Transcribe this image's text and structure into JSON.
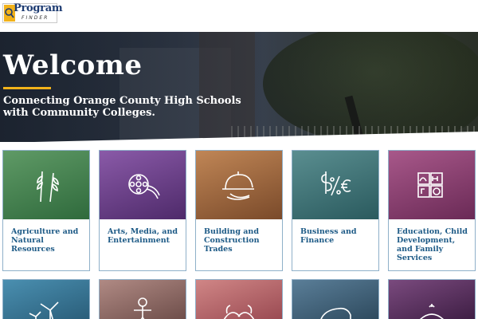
{
  "logo": {
    "word1": "Program",
    "word2": "FINDER"
  },
  "hero": {
    "title": "Welcome",
    "tagline": "Connecting Orange County High Schools with Community Colleges."
  },
  "cards": [
    {
      "label": "Agriculture and Natural Resources",
      "icon": "wheat-icon",
      "color": "#3f7a4a"
    },
    {
      "label": "Arts, Media, and Entertainment",
      "icon": "film-reel-icon",
      "color": "#6e3f8a"
    },
    {
      "label": "Building and Construction Trades",
      "icon": "hardhat-icon",
      "color": "#a0623c"
    },
    {
      "label": "Business and Finance",
      "icon": "currency-icon",
      "color": "#3c6e74"
    },
    {
      "label": "Education, Child Development, and Family Services",
      "icon": "blocks-icon",
      "color": "#8a3e6e"
    }
  ],
  "row2": [
    {
      "icon": "wind-turbine-icon",
      "color": "#2f6e8c"
    },
    {
      "icon": "stick-figure-icon",
      "color": "#8c6a64"
    },
    {
      "icon": "hands-icon",
      "color": "#b86a6a"
    },
    {
      "icon": "car-icon",
      "color": "#3e6078"
    },
    {
      "icon": "food-icon",
      "color": "#5a2f5e"
    }
  ]
}
